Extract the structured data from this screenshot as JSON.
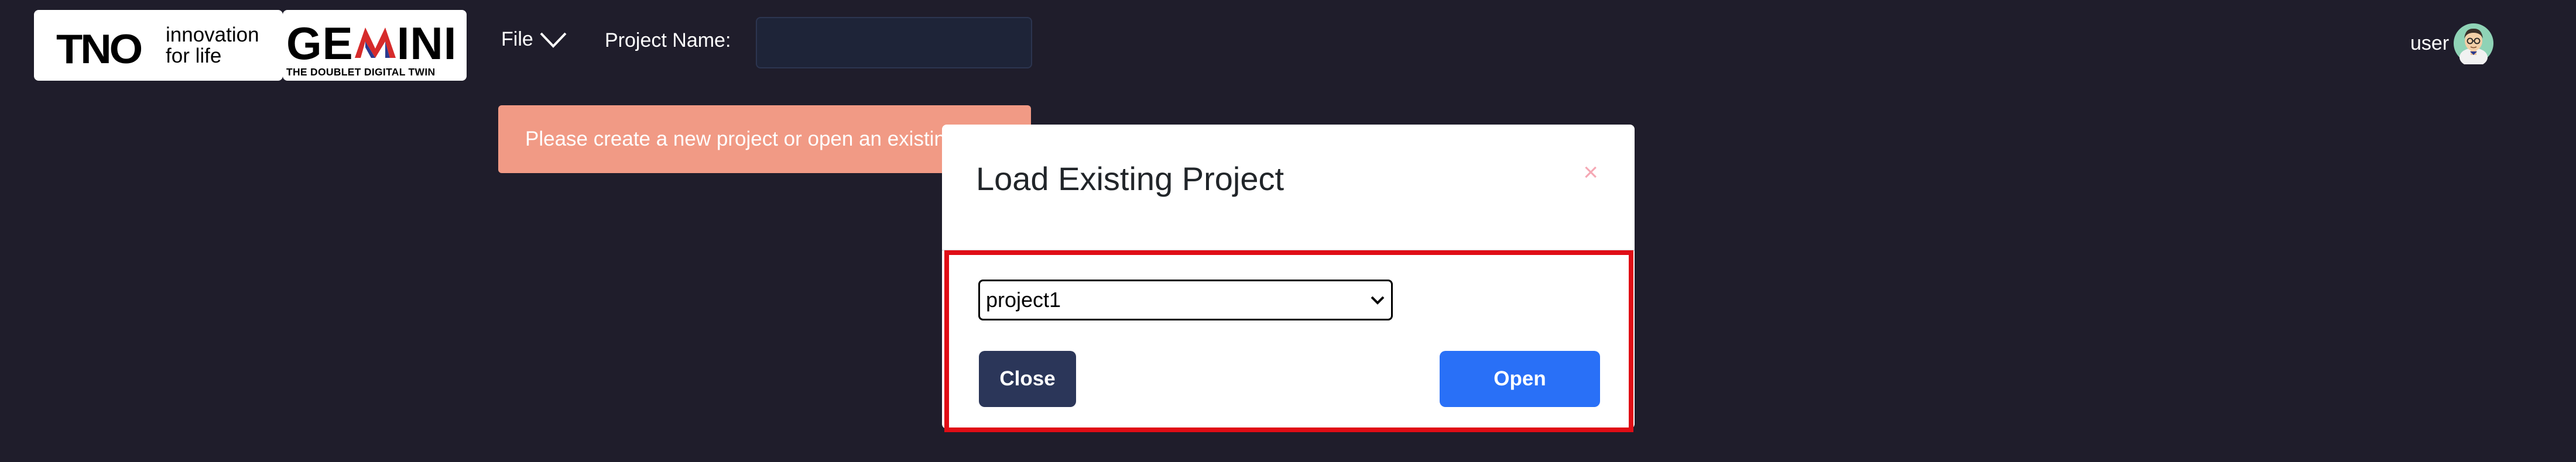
{
  "header": {
    "tno_logo": {
      "wordmark": "TNO",
      "tagline_line1": "innovation",
      "tagline_line2": "for life"
    },
    "gemini_logo": {
      "wordmark_left": "GE",
      "wordmark_right": "INI",
      "subtitle": "THE DOUBLET DIGITAL TWIN"
    },
    "file_menu_label": "File",
    "project_name_label": "Project Name:",
    "project_name_value": "",
    "user_label": "user"
  },
  "alert": {
    "text": "Please create a new project or open an existing project"
  },
  "modal": {
    "title": "Load Existing Project",
    "close_symbol": "×",
    "selected_project": "project1",
    "close_button_label": "Close",
    "open_button_label": "Open"
  },
  "colors": {
    "background": "#1f1d2b",
    "alert": "#f19a85",
    "highlight_border": "#e00d16",
    "close_button": "#2b3659",
    "open_button": "#2970f7",
    "gemini_m_red": "#d62b2b",
    "gemini_m_blue": "#2b3a8f"
  },
  "icons": {
    "file_menu": "chevron-down-icon",
    "user": "avatar-icon",
    "select": "chevron-down-icon"
  }
}
